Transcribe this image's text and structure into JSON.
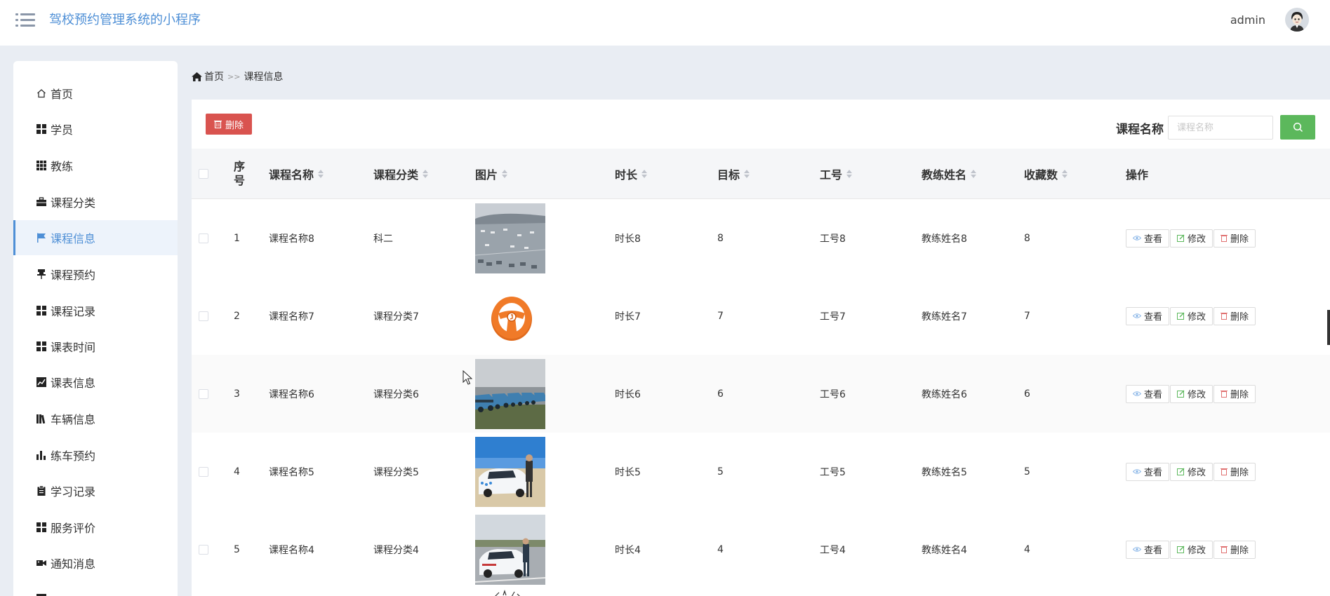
{
  "header": {
    "app_title": "驾校预约管理系统的小程序",
    "user_name": "admin",
    "menu_icon": "hamburger-menu-icon",
    "avatar_icon": "user-avatar"
  },
  "sidebar": {
    "items": [
      {
        "label": "首页",
        "icon": "home-icon",
        "active": false
      },
      {
        "label": "学员",
        "icon": "grid-icon",
        "active": false
      },
      {
        "label": "教练",
        "icon": "grid-dots-icon",
        "active": false
      },
      {
        "label": "课程分类",
        "icon": "briefcase-icon",
        "active": false
      },
      {
        "label": "课程信息",
        "icon": "flag-icon",
        "active": true
      },
      {
        "label": "课程预约",
        "icon": "pin-icon",
        "active": false
      },
      {
        "label": "课程记录",
        "icon": "grid-icon",
        "active": false
      },
      {
        "label": "课表时间",
        "icon": "grid-icon",
        "active": false
      },
      {
        "label": "课表信息",
        "icon": "line-chart-icon",
        "active": false
      },
      {
        "label": "车辆信息",
        "icon": "books-icon",
        "active": false
      },
      {
        "label": "练车预约",
        "icon": "bar-chart-icon",
        "active": false
      },
      {
        "label": "学习记录",
        "icon": "clipboard-icon",
        "active": false
      },
      {
        "label": "服务评价",
        "icon": "grid-icon",
        "active": false
      },
      {
        "label": "通知消息",
        "icon": "video-icon",
        "active": false
      }
    ]
  },
  "breadcrumb": {
    "home": "首页",
    "separator": ">>",
    "current": "课程信息"
  },
  "toolbar": {
    "delete_label": "删除",
    "search_label": "课程名称",
    "search_placeholder": "课程名称",
    "search_value": ""
  },
  "table": {
    "columns": [
      "序号",
      "课程名称",
      "课程分类",
      "图片",
      "时长",
      "目标",
      "工号",
      "教练姓名",
      "收藏数",
      "操作"
    ],
    "rows": [
      {
        "index": "1",
        "name": "课程名称8",
        "category": "科二",
        "image": "parking-lot-photo",
        "duration": "时长8",
        "target": "8",
        "job_no": "工号8",
        "coach": "教练姓名8",
        "favorites": "8"
      },
      {
        "index": "2",
        "name": "课程名称7",
        "category": "课程分类7",
        "image": "steering-wheel-photo",
        "duration": "时长7",
        "target": "7",
        "job_no": "工号7",
        "coach": "教练姓名7",
        "favorites": "7"
      },
      {
        "index": "3",
        "name": "课程名称6",
        "category": "课程分类6",
        "image": "blue-cars-row-photo",
        "duration": "时长6",
        "target": "6",
        "job_no": "工号6",
        "coach": "教练姓名6",
        "favorites": "6"
      },
      {
        "index": "4",
        "name": "课程名称5",
        "category": "课程分类5",
        "image": "white-car-instructor-photo",
        "duration": "时长5",
        "target": "5",
        "job_no": "工号5",
        "coach": "教练姓名5",
        "favorites": "5"
      },
      {
        "index": "5",
        "name": "课程名称4",
        "category": "课程分类4",
        "image": "white-car-road-photo",
        "duration": "时长4",
        "target": "4",
        "job_no": "工号4",
        "coach": "教练姓名4",
        "favorites": "4"
      }
    ],
    "actions": {
      "view": "查看",
      "edit": "修改",
      "delete": "删除"
    }
  },
  "colors": {
    "accent": "#4e8fd6",
    "danger": "#d9534f",
    "success": "#5cb85c",
    "background": "#e9edf3"
  }
}
